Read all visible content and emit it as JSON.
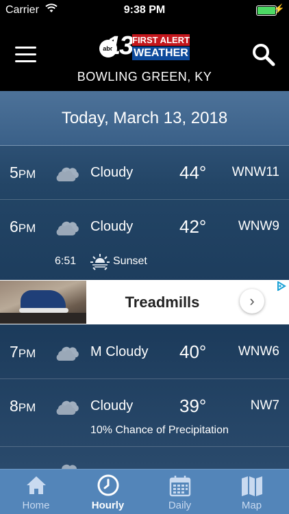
{
  "status_bar": {
    "carrier": "Carrier",
    "time": "9:38 PM",
    "battery_level": 1.0
  },
  "header": {
    "logo": {
      "station": "abc",
      "channel": "13",
      "line1": "FIRST ALERT",
      "line2": "WEATHER"
    },
    "location": "BOWLING GREEN, KY"
  },
  "forecast": {
    "date": "Today, March 13, 2018",
    "hours": [
      {
        "hour": "5",
        "period": "PM",
        "condition": "Cloudy",
        "temp": "44°",
        "wind": "WNW11",
        "icon": "cloud-icon"
      },
      {
        "hour": "6",
        "period": "PM",
        "condition": "Cloudy",
        "temp": "42°",
        "wind": "WNW9",
        "icon": "cloud-icon"
      },
      {
        "hour": "7",
        "period": "PM",
        "condition": "M Cloudy",
        "temp": "40°",
        "wind": "WNW6",
        "icon": "cloud-icon"
      },
      {
        "hour": "8",
        "period": "PM",
        "condition": "Cloudy",
        "temp": "39°",
        "wind": "NW7",
        "icon": "cloud-icon"
      }
    ],
    "sunset": {
      "time": "6:51",
      "label": "Sunset"
    },
    "precip_note": "10% Chance of Precipitation"
  },
  "ad": {
    "title": "Treadmills",
    "arrow": "›"
  },
  "tabs": [
    {
      "label": "Home",
      "icon": "home-icon",
      "active": false
    },
    {
      "label": "Hourly",
      "icon": "clock-icon",
      "active": true
    },
    {
      "label": "Daily",
      "icon": "calendar-icon",
      "active": false
    },
    {
      "label": "Map",
      "icon": "map-icon",
      "active": false
    }
  ],
  "colors": {
    "header_bg": "#000000",
    "tab_bar": "#5385b9",
    "battery": "#4cd964",
    "logo_red": "#c4161c",
    "logo_blue": "#0d4a9c"
  }
}
